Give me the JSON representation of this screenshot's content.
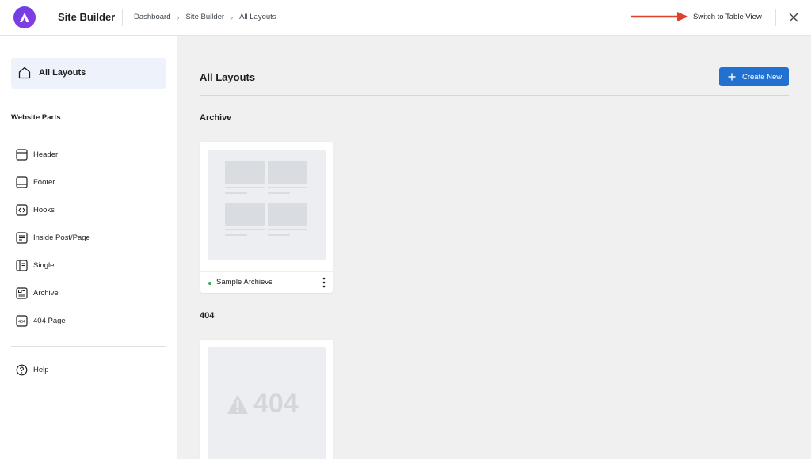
{
  "header": {
    "app_title": "Site Builder",
    "breadcrumb": [
      "Dashboard",
      "Site Builder",
      "All Layouts"
    ],
    "breadcrumb_sep": "›",
    "switch_view_label": "Switch to Table View",
    "annotation_arrow_color": "#e0402e"
  },
  "sidebar": {
    "all_layouts_label": "All Layouts",
    "section_title": "Website Parts",
    "items": [
      {
        "label": "Header",
        "icon": "header-icon"
      },
      {
        "label": "Footer",
        "icon": "footer-icon"
      },
      {
        "label": "Hooks",
        "icon": "hooks-icon"
      },
      {
        "label": "Inside Post/Page",
        "icon": "inside-post-icon"
      },
      {
        "label": "Single",
        "icon": "single-icon"
      },
      {
        "label": "Archive",
        "icon": "archive-icon"
      },
      {
        "label": "404 Page",
        "icon": "404-page-icon"
      }
    ],
    "help_label": "Help",
    "active_bg": "#eef3fb"
  },
  "main": {
    "title": "All Layouts",
    "create_button_label": "Create New",
    "accent": "#2271d1",
    "groups": [
      {
        "title": "Archive",
        "cards": [
          {
            "name": "Sample Archieve",
            "status_color": "#3aa65d"
          }
        ]
      },
      {
        "title": "404",
        "cards": [
          {
            "placeholder_text": "404"
          }
        ]
      }
    ]
  }
}
